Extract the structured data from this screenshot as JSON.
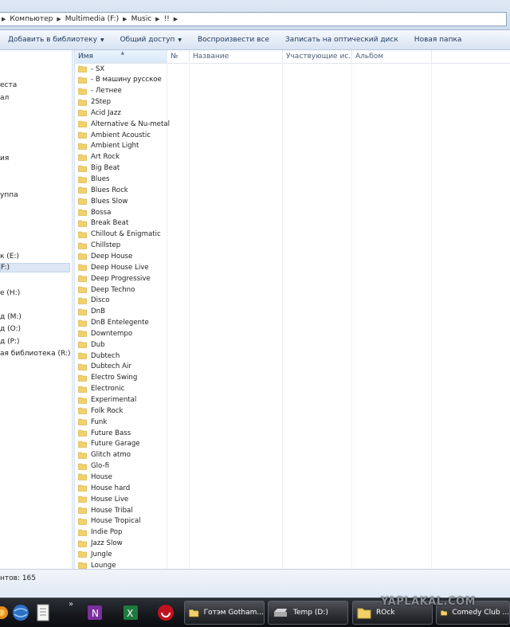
{
  "address": {
    "crumbs": [
      "Компьютер",
      "Multimedia (F:)",
      "Music",
      "!!"
    ]
  },
  "toolbar": {
    "add_library": "Добавить в библиотеку",
    "share": "Общий доступ",
    "play_all": "Воспроизвести все",
    "burn": "Записать на оптический диск",
    "new_folder": "Новая папка"
  },
  "nav": {
    "items": [
      "еста",
      "ал",
      "ия",
      "уппа",
      "к (E:)",
      "F:)",
      "е (H:)",
      "д (M:)",
      "д (O:)",
      "д (P:)",
      "ая библиотека (R:)"
    ]
  },
  "columns": {
    "name": "Имя",
    "number": "№",
    "title": "Название",
    "artists": "Участвующие ис...",
    "album": "Альбом"
  },
  "folders": [
    "- SX",
    "- В машину русское",
    "- Летнее",
    "2Step",
    "Acid Jazz",
    "Alternative & Nu-metal",
    "Ambient Acoustic",
    "Ambient Light",
    "Art Rock",
    "Big Beat",
    "Blues",
    "Blues Rock",
    "Blues Slow",
    "Bossa",
    "Break Beat",
    "Chillout & Enigmatic",
    "Chillstep",
    "Deep House",
    "Deep House Live",
    "Deep Progressive",
    "Deep Techno",
    "Disco",
    "DnB",
    "DnB Entelegente",
    "Downtempo",
    "Dub",
    "Dubtech",
    "Dubtech Air",
    "Electro Swing",
    "Electronic",
    "Experimental",
    "Folk Rock",
    "Funk",
    "Future Bass",
    "Future Garage",
    "Glitch atmo",
    "Glo-fi",
    "House",
    "House hard",
    "House Live",
    "House Tribal",
    "House Tropical",
    "Indie Pop",
    "Jazz Slow",
    "Jungle",
    "Lounge"
  ],
  "status": {
    "text": "нтов: 165"
  },
  "taskbar": {
    "tasks": [
      "Готэм Gotham...",
      "Temp (D:)",
      "ROck",
      "Comedy Club ..."
    ],
    "more": "»"
  },
  "watermark": "YAPLAKAL.COM",
  "colors": {
    "folder": "#f2d16b",
    "toolbar_bg": "#e4ecf7",
    "taskbar_bg": "#15171b"
  }
}
